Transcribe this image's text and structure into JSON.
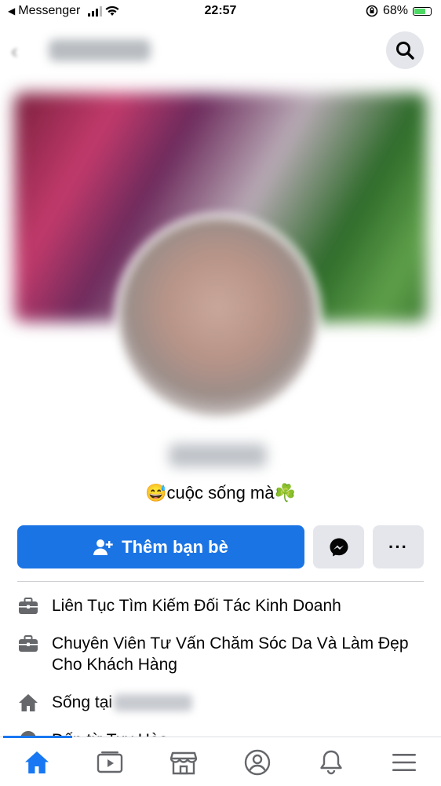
{
  "status_bar": {
    "back_app": "Messenger",
    "time": "22:57",
    "battery": "68%"
  },
  "profile": {
    "bio": "😅cuộc sống mà☘️",
    "add_friend_label": "Thêm bạn bè",
    "more_label": "···"
  },
  "intro": {
    "work1": "Liên Tục Tìm Kiếm Đối Tác Kinh Doanh",
    "work2": "Chuyên Viên Tư Vấn Chăm Sóc Da Và Làm Đẹp Cho Khách Hàng",
    "lives_in": "Sống tại",
    "from_partial": "Đến từ Tuy Hòa"
  },
  "colors": {
    "accent": "#1b74e4",
    "button_gray": "#e4e6eb",
    "icon_gray": "#65676b"
  },
  "tabs": [
    {
      "icon": "home-icon",
      "active": true
    },
    {
      "icon": "video-icon",
      "active": false
    },
    {
      "icon": "marketplace-icon",
      "active": false
    },
    {
      "icon": "profile-icon",
      "active": false
    },
    {
      "icon": "bell-icon",
      "active": false
    },
    {
      "icon": "menu-icon",
      "active": false
    }
  ]
}
